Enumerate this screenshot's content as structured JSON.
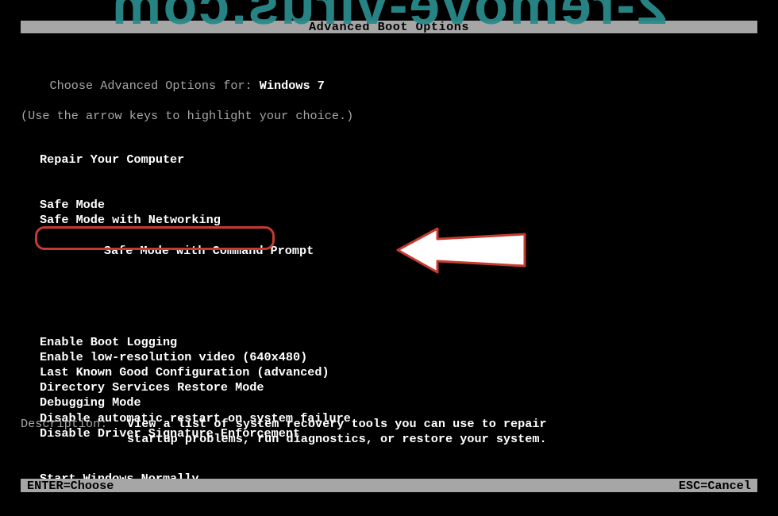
{
  "watermark_text": "2-remove-virus.com",
  "title": "Advanced Boot Options",
  "intro": {
    "prefix": "Choose Advanced Options for: ",
    "os": "Windows 7",
    "hint": "(Use the arrow keys to highlight your choice.)"
  },
  "menu": {
    "blocks": [
      {
        "items": [
          {
            "label": "Repair Your Computer",
            "highlight": false
          }
        ]
      },
      {
        "items": [
          {
            "label": "Safe Mode",
            "highlight": false
          },
          {
            "label": "Safe Mode with Networking",
            "highlight": false
          },
          {
            "label": "Safe Mode with Command Prompt",
            "highlight": true
          }
        ]
      },
      {
        "items": [
          {
            "label": "Enable Boot Logging",
            "highlight": false
          },
          {
            "label": "Enable low-resolution video (640x480)",
            "highlight": false
          },
          {
            "label": "Last Known Good Configuration (advanced)",
            "highlight": false
          },
          {
            "label": "Directory Services Restore Mode",
            "highlight": false
          },
          {
            "label": "Debugging Mode",
            "highlight": false
          },
          {
            "label": "Disable automatic restart on system failure",
            "highlight": false
          },
          {
            "label": "Disable Driver Signature Enforcement",
            "highlight": false
          }
        ]
      },
      {
        "items": [
          {
            "label": "Start Windows Normally",
            "highlight": false
          }
        ]
      }
    ]
  },
  "description": {
    "label": "Description:",
    "text_line1": "View a list of system recovery tools you can use to repair",
    "text_line2": "startup problems, run diagnostics, or restore your system."
  },
  "footer": {
    "left": "ENTER=Choose",
    "right": "ESC=Cancel"
  }
}
